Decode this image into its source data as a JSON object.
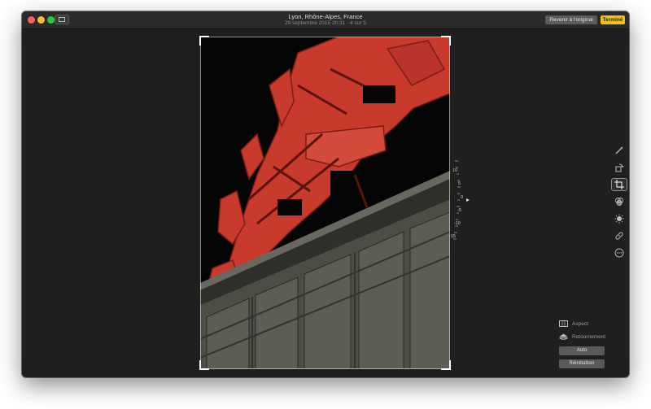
{
  "window": {
    "title": "Lyon, Rhône-Alpes, France",
    "subtitle": "29 septembre 2015 20:31 · 4 sur 5"
  },
  "toolbar": {
    "revert_label": "Revenir à l'original",
    "done_label": "Terminé",
    "done_color": "#f3c018"
  },
  "straighten_dial": {
    "ticks": [
      "10",
      "5",
      "0",
      "-5",
      "-10",
      "-15"
    ]
  },
  "tools": [
    {
      "name": "magic-wand-icon",
      "active": false
    },
    {
      "name": "rotate-icon",
      "active": false
    },
    {
      "name": "crop-icon",
      "active": true
    },
    {
      "name": "filters-icon",
      "active": false
    },
    {
      "name": "adjust-icon",
      "active": false
    },
    {
      "name": "retouch-icon",
      "active": false
    },
    {
      "name": "more-icon",
      "active": false
    }
  ],
  "crop_options": {
    "aspect_label": "Aspect",
    "flip_label": "Retournement",
    "auto_label": "Auto",
    "reset_label": "Réinitialiser"
  }
}
